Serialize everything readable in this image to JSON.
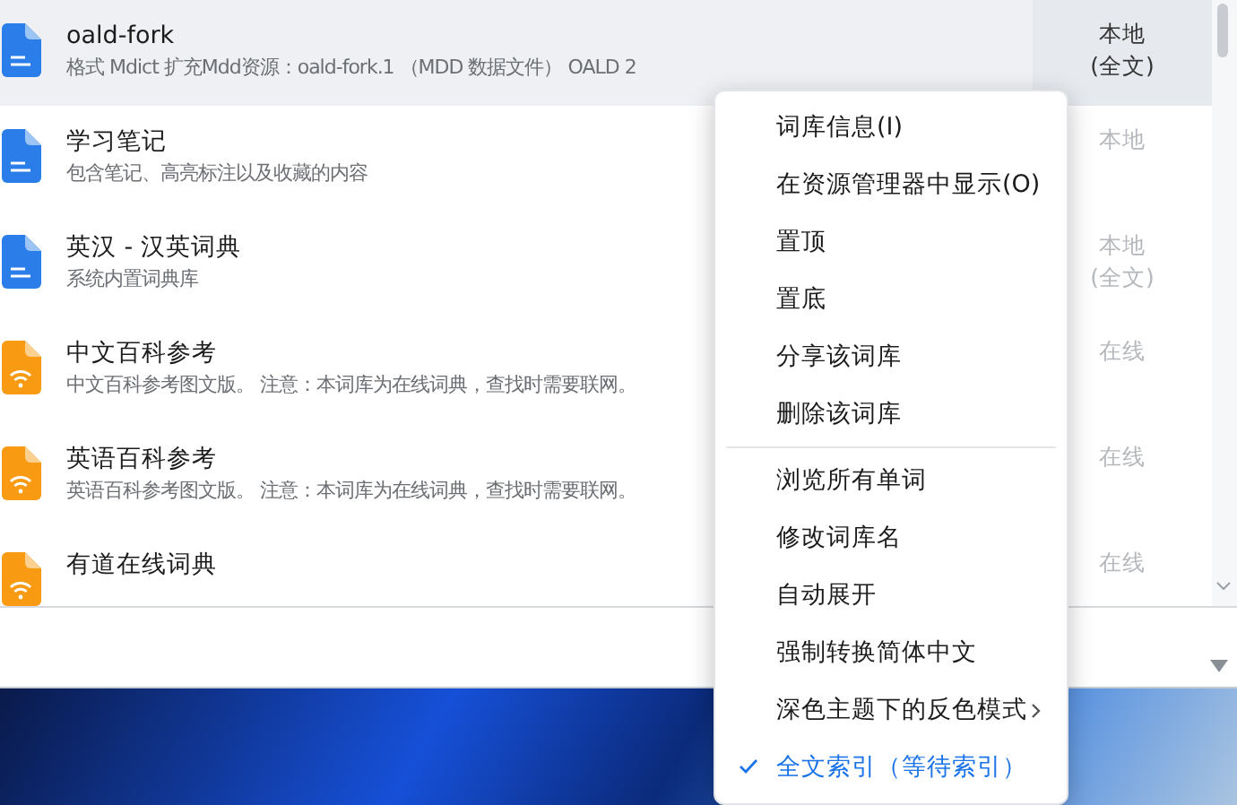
{
  "dictionaries": [
    {
      "title": "oald-fork",
      "description": "格式 Mdict  扩充Mdd资源：oald-fork.1 （MDD 数据文件）  OALD 2",
      "status": "本地\n(全文)",
      "kind": "local",
      "selected": true
    },
    {
      "title": "学习笔记",
      "description": "包含笔记、高亮标注以及收藏的内容",
      "status": "本地",
      "kind": "local",
      "selected": false
    },
    {
      "title": "英汉 - 汉英词典",
      "description": "系统内置词典库",
      "status": "本地\n(全文)",
      "kind": "local",
      "selected": false
    },
    {
      "title": "中文百科参考",
      "description": "中文百科参考图文版。  注意：本词库为在线词典，查找时需要联网。",
      "status": "在线",
      "kind": "online",
      "selected": false
    },
    {
      "title": "英语百科参考",
      "description": "英语百科参考图文版。  注意：本词库为在线词典，查找时需要联网。",
      "status": "在线",
      "kind": "online",
      "selected": false
    },
    {
      "title": "有道在线词典",
      "status": "在线",
      "kind": "online",
      "selected": false
    }
  ],
  "context_menu": [
    {
      "label": "词库信息(I)",
      "kind": "item"
    },
    {
      "label": "在资源管理器中显示(O)",
      "kind": "item"
    },
    {
      "label": "置顶",
      "kind": "item"
    },
    {
      "label": "置底",
      "kind": "item"
    },
    {
      "label": "分享该词库",
      "kind": "item"
    },
    {
      "label": "删除该词库",
      "kind": "item"
    },
    {
      "kind": "separator"
    },
    {
      "label": "浏览所有单词",
      "kind": "item"
    },
    {
      "label": "修改词库名",
      "kind": "item"
    },
    {
      "label": "自动展开",
      "kind": "item"
    },
    {
      "label": "强制转换简体中文",
      "kind": "item"
    },
    {
      "label": "深色主题下的反色模式",
      "kind": "submenu"
    },
    {
      "label": "全文索引（等待索引）",
      "kind": "check",
      "checked": true
    }
  ]
}
